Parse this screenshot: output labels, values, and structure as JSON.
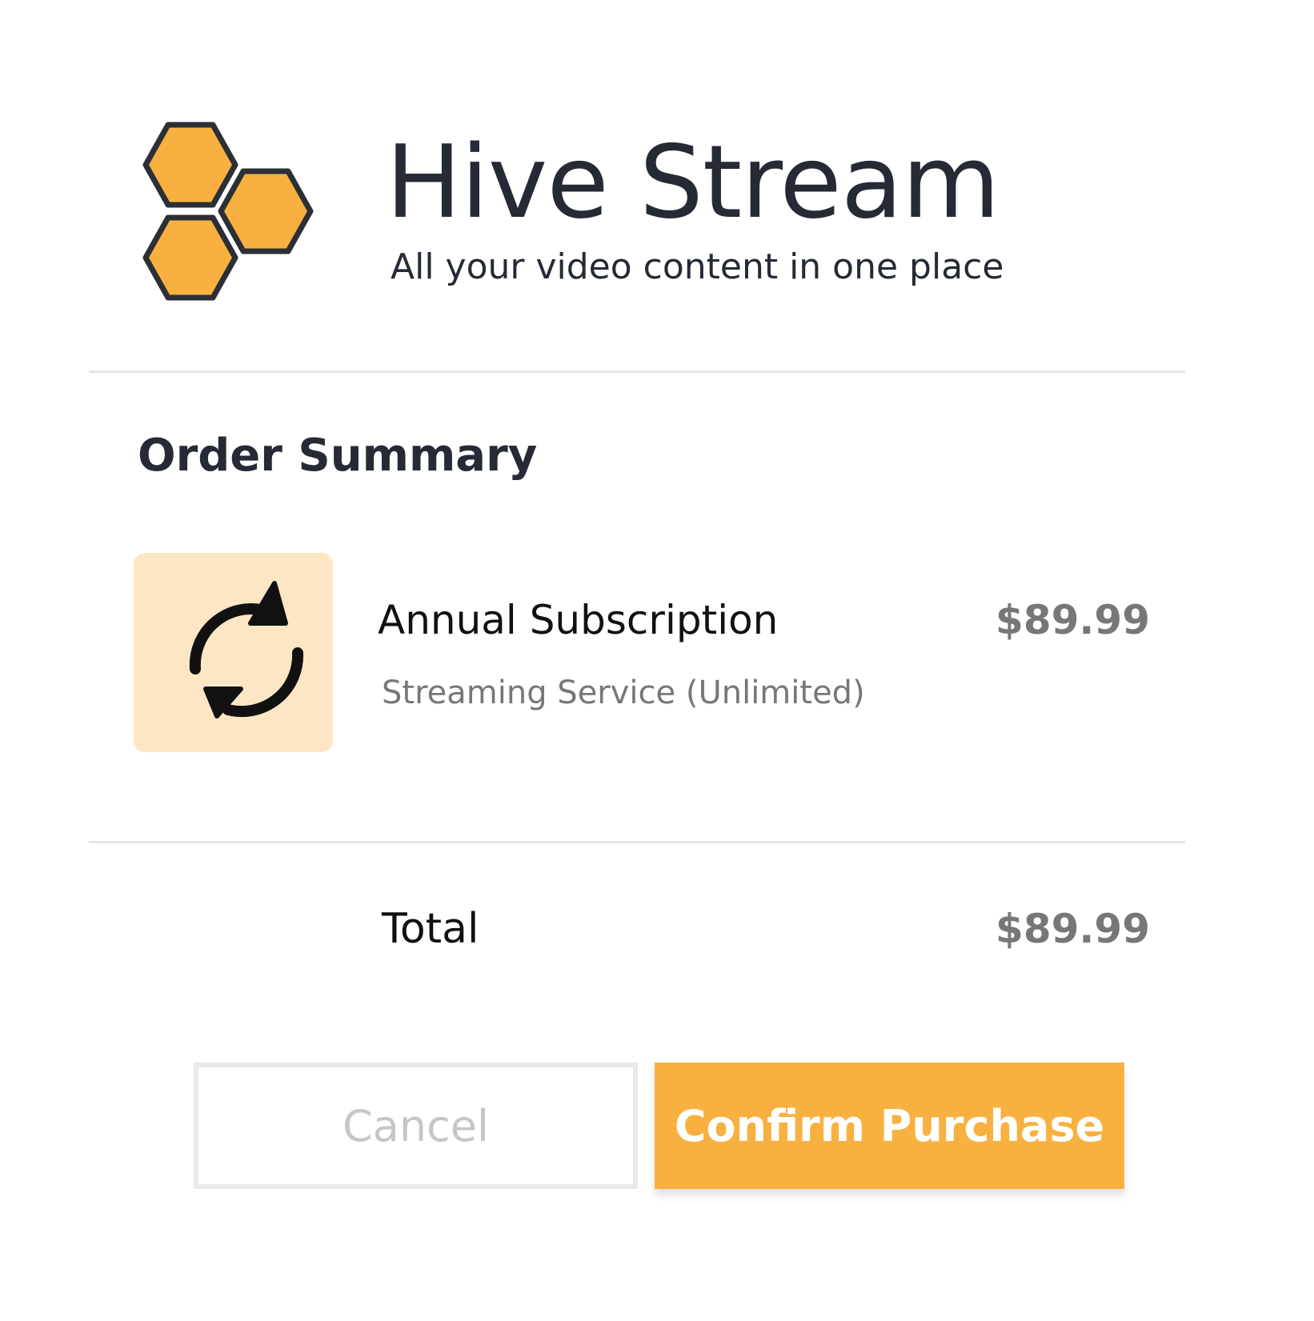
{
  "brand": {
    "name": "Hive Stream",
    "tagline": "All your video content in one place",
    "logo_icon": "honeycomb-logo-icon",
    "accent_color": "#f8b140"
  },
  "order": {
    "title": "Order Summary",
    "item": {
      "icon": "refresh-cycle-icon",
      "name": "Annual Subscription",
      "description": "Streaming Service (Unlimited)",
      "price": "$89.99"
    },
    "total_label": "Total",
    "total_value": "$89.99"
  },
  "actions": {
    "cancel_label": "Cancel",
    "confirm_label": "Confirm Purchase"
  }
}
